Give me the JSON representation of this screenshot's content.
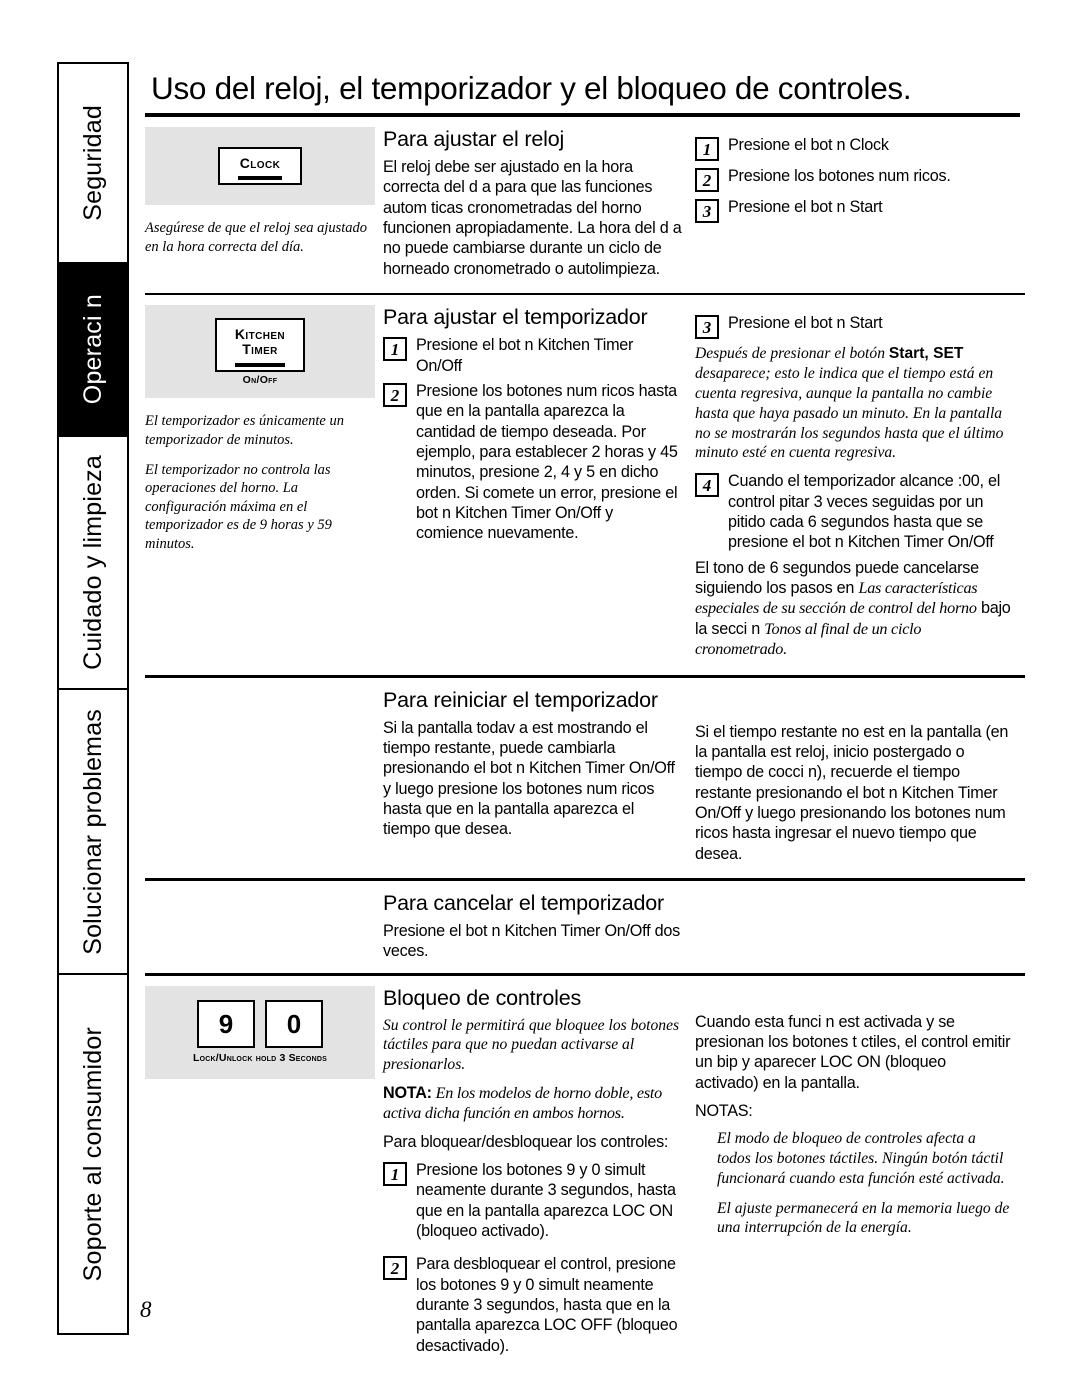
{
  "page_number": "8",
  "sidebar": {
    "tabs": [
      {
        "label": "Seguridad",
        "active": false
      },
      {
        "label": "Operaci n",
        "active": true
      },
      {
        "label": "Cuidado y limpieza",
        "active": false
      },
      {
        "label": "Solucionar problemas",
        "active": false
      },
      {
        "label": "Soporte al consumidor",
        "active": false
      }
    ]
  },
  "title": "Uso del reloj, el temporizador y el bloqueo de controles.",
  "sections": {
    "clock": {
      "illustration": {
        "button_label": "Clock",
        "icon": "clock-button-icon"
      },
      "note": "Asegúrese de que el reloj sea ajustado en la hora correcta del día.",
      "heading": "Para ajustar el reloj",
      "body": "El reloj debe ser ajustado en la hora correcta del d a para que las funciones autom ticas cronometradas del horno funcionen apropiadamente. La hora del d a no puede cambiarse durante un ciclo de horneado cronometrado o autolimpieza.",
      "steps": [
        {
          "num": "1",
          "text": "Presione el bot n  Clock"
        },
        {
          "num": "2",
          "text": "Presione los botones num ricos."
        },
        {
          "num": "3",
          "text": "Presione el bot n  Start"
        }
      ]
    },
    "timer": {
      "illustration": {
        "button_label_line1": "Kitchen",
        "button_label_line2": "Timer",
        "button_sublabel": "On/Off",
        "icon": "kitchen-timer-button-icon"
      },
      "notes": [
        "El temporizador es únicamente un temporizador de minutos.",
        "El temporizador no controla las operaciones del horno. La configuración máxima en el temporizador es de 9 horas y 59 minutos."
      ],
      "heading": "Para ajustar el temporizador",
      "steps_left": [
        {
          "num": "1",
          "text": "Presione el bot n  Kitchen Timer On/Off"
        },
        {
          "num": "2",
          "text": "Presione los botones num ricos hasta que en la pantalla aparezca la cantidad de tiempo deseada. Por ejemplo, para establecer 2 horas y 45 minutos, presione 2, 4 y 5 en dicho orden. Si comete un error, presione el bot n  Kitchen Timer On/Off y comience nuevamente."
        }
      ],
      "steps_right": [
        {
          "num": "3",
          "text": "Presione el bot n  Start"
        }
      ],
      "italic_note_prefix": "Después de presionar el botón ",
      "italic_note_bold": "Start",
      "italic_note_bold2": ", SET",
      "italic_note_rest": " desaparece; esto le indica que el tiempo está en cuenta regresiva, aunque la pantalla no cambie hasta que haya pasado un minuto. En la pantalla no se mostrarán los segundos hasta que el último minuto esté en cuenta regresiva.",
      "step4": {
        "num": "4",
        "text": "Cuando el temporizador alcance :00, el control pitar  3 veces seguidas por un pitido cada 6 segundos hasta que se presione el bot n Kitchen Timer On/Off"
      },
      "tail_plain1": "El tono de 6 segundos puede cancelarse siguiendo los pasos en ",
      "tail_ital1": "Las características especiales de su sección de control del horno",
      "tail_plain2": " bajo la secci n ",
      "tail_ital2": "Tonos al final de un ciclo cronometrado."
    },
    "restart": {
      "heading": "Para reiniciar el temporizador",
      "left_body": "Si la pantalla todav a est  mostrando el tiempo restante, puede cambiarla presionando el bot n  Kitchen Timer On/Off y luego presione los botones num ricos hasta que en la pantalla aparezca el tiempo que desea.",
      "right_body": "Si el tiempo restante no est  en la pantalla (en la pantalla est  reloj, inicio postergado o tiempo de cocci n), recuerde el tiempo restante presionando el bot n  Kitchen Timer On/Off y luego presionando los botones num ricos hasta ingresar el nuevo tiempo que desea."
    },
    "cancel": {
      "heading": "Para cancelar el temporizador",
      "body": "Presione el bot n  Kitchen Timer On/Off dos veces."
    },
    "lock": {
      "illustration": {
        "key_1": "9",
        "key_2": "0",
        "caption": "Lock/Unlock hold 3 Seconds",
        "icon": "keypad-lock-icon"
      },
      "heading": "Bloqueo de controles",
      "intro_italic": "Su control le permitirá que bloquee los botones táctiles para que no puedan activarse al presionarlos.",
      "nota_label": "NOTA:",
      "nota_italic": " En los modelos de horno doble, esto activa dicha función en ambos hornos.",
      "instructions_label": "Para bloquear/desbloquear los controles:",
      "steps": [
        {
          "num": "1",
          "text": "Presione los botones 9 y 0 simult neamente durante 3 segundos, hasta que en la pantalla aparezca LOC ON (bloqueo activado)."
        },
        {
          "num": "2",
          "text": "Para desbloquear el control, presione los botones 9 y 0 simult neamente durante 3 segundos, hasta que en la pantalla aparezca LOC OFF (bloqueo desactivado)."
        }
      ],
      "right_body": "Cuando esta funci n est  activada y se presionan los botones t ctiles, el control emitir  un bip y aparecer   LOC ON (bloqueo activado) en la pantalla.",
      "notes_label": "NOTAS:",
      "notes": [
        "El modo de bloqueo de controles afecta a todos los botones táctiles. Ningún botón táctil funcionará cuando esta función esté activada.",
        "El ajuste permanecerá en la memoria luego de una interrupción de la energía."
      ]
    }
  }
}
